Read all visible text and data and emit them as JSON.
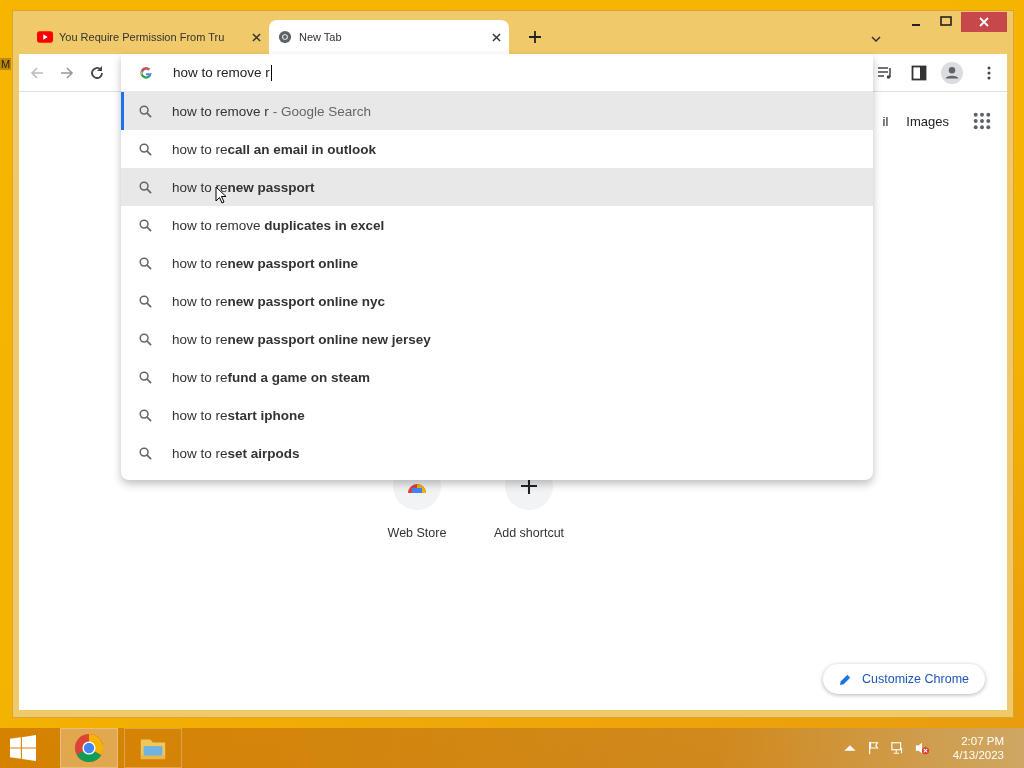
{
  "desktop": {
    "label": "M"
  },
  "tabs": [
    {
      "title": "You Require Permission From Tru",
      "kind": "video",
      "selected": false
    },
    {
      "title": "New Tab",
      "kind": "browser",
      "selected": true
    }
  ],
  "omnibox": {
    "value": "how to remove r"
  },
  "suggestions": [
    {
      "text": "how to remove r",
      "suffix": "- Google Search",
      "selected": true,
      "hovered": false
    },
    {
      "text": "how to re**call an email in outlook**",
      "selected": false,
      "hovered": false
    },
    {
      "text": "how to re**new passport**",
      "selected": false,
      "hovered": true
    },
    {
      "text": "how to remove **duplicates in excel**",
      "selected": false,
      "hovered": false
    },
    {
      "text": "how to re**new passport online**",
      "selected": false,
      "hovered": false
    },
    {
      "text": "how to re**new passport online nyc**",
      "selected": false,
      "hovered": false
    },
    {
      "text": "how to re**new passport online new jersey**",
      "selected": false,
      "hovered": false
    },
    {
      "text": "how to re**fund a game on steam**",
      "selected": false,
      "hovered": false
    },
    {
      "text": "how to re**start iphone**",
      "selected": false,
      "hovered": false
    },
    {
      "text": "how to re**set airpods**",
      "selected": false,
      "hovered": false
    }
  ],
  "header_links": [
    "il",
    "Images"
  ],
  "shortcuts": [
    {
      "label": "Web Store",
      "kind": "webstore"
    },
    {
      "label": "Add shortcut",
      "kind": "add"
    }
  ],
  "customize": {
    "label": "Customize Chrome"
  },
  "clock": {
    "time": "2:07 PM",
    "date": "4/13/2023"
  }
}
